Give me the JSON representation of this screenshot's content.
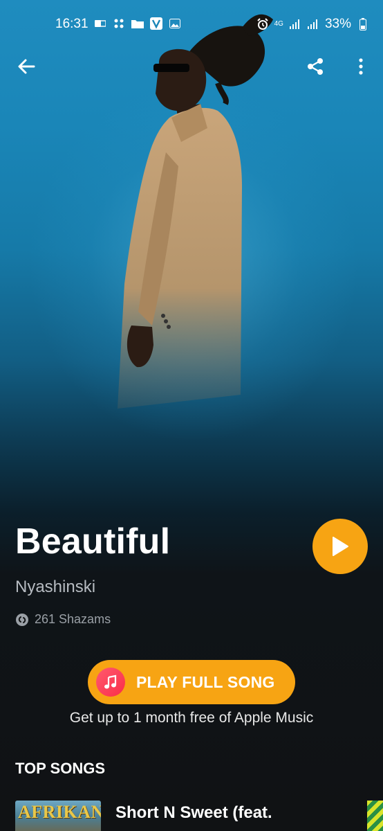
{
  "status_bar": {
    "time": "16:31",
    "battery": "33%",
    "network": "4G"
  },
  "header": {
    "back_icon": "arrow-left-icon",
    "share_icon": "share-icon",
    "more_icon": "more-vertical-icon"
  },
  "track": {
    "title": "Beautiful",
    "artist": "Nyashinski",
    "shazams": "261 Shazams"
  },
  "apple_music": {
    "button_label": "PLAY FULL SONG",
    "promo": "Get up to 1 month free of Apple Music"
  },
  "top_songs": {
    "heading": "TOP SONGS",
    "items": [
      {
        "title": "Short N Sweet (feat.",
        "thumb_text": "AFRIKAN"
      }
    ]
  },
  "colors": {
    "accent": "#f7a413",
    "apple_music": "#fa2d48",
    "background_top": "#1f8cbf",
    "background_bottom": "#101214"
  }
}
